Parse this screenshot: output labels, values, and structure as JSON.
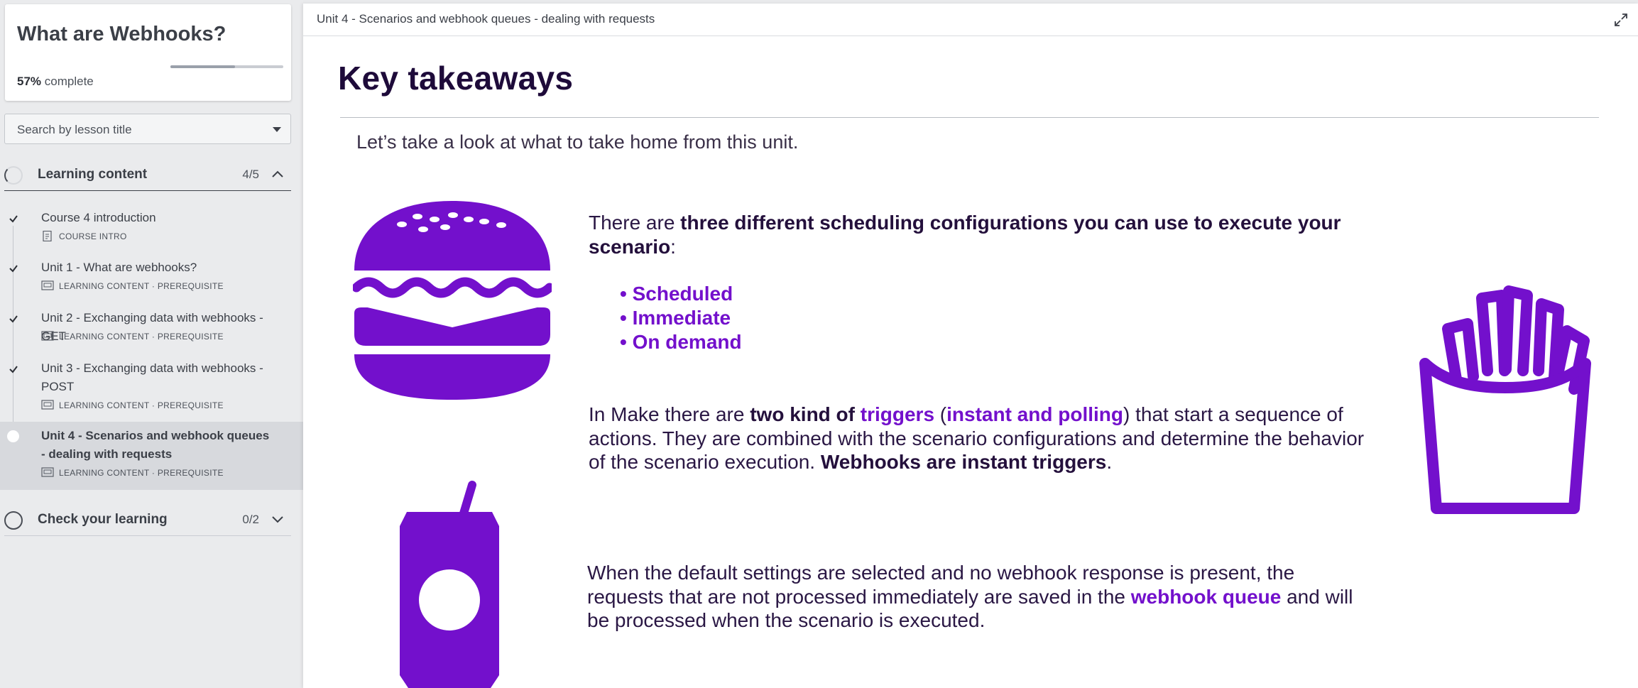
{
  "course": {
    "title": "What are Webhooks?",
    "progress_percent": "57%",
    "progress_label": "complete",
    "progress_fraction": 0.57
  },
  "search": {
    "placeholder": "Search by lesson title"
  },
  "sections": [
    {
      "label": "Learning content",
      "count": "4/5",
      "icon": "chevron-up-icon"
    },
    {
      "label": "Check your learning",
      "count": "0/2",
      "icon": "chevron-down-icon"
    }
  ],
  "lessons": [
    {
      "title": "Course 4 introduction",
      "meta": "COURSE INTRO",
      "status": "complete"
    },
    {
      "title": "Unit 1 - What are webhooks?",
      "meta": "LEARNING CONTENT · PREREQUISITE",
      "status": "complete"
    },
    {
      "title": "Unit 2 - Exchanging data with webhooks - GET",
      "meta": "LEARNING CONTENT · PREREQUISITE",
      "status": "complete"
    },
    {
      "title": "Unit 3 - Exchanging data with webhooks - POST",
      "meta": "LEARNING CONTENT · PREREQUISITE",
      "status": "complete"
    },
    {
      "title": "Unit 4 - Scenarios and webhook queues - dealing with requests",
      "meta": "LEARNING CONTENT · PREREQUISITE",
      "status": "current"
    }
  ],
  "main": {
    "breadcrumb": "Unit 4 - Scenarios and webhook queues - dealing with requests",
    "title": "Key takeaways",
    "intro": "Let’s take a look at what to take home from this unit.",
    "p1": {
      "a": "There are ",
      "b": "three different scheduling configurations you can use to execute your scenario",
      "c": ":"
    },
    "bullets": [
      "Scheduled",
      "Immediate",
      "On demand"
    ],
    "p2": {
      "a": "In Make there are ",
      "b": "two kind of ",
      "c": "triggers",
      "d": " (",
      "e": "instant and polling",
      "f": ") that start a sequence of actions. They are combined with the scenario configurations and determine the behavior of the scenario execution. ",
      "g": "Webhooks are instant triggers",
      "h": "."
    },
    "p3": {
      "a": "When the default settings are selected and no webhook response is present, the requests that are not processed immediately are saved in the ",
      "b": "webhook queue",
      "c": " and will be processed when the scenario is executed."
    }
  },
  "colors": {
    "accent": "#7310cc",
    "heading": "#1e0b3a",
    "sidebar_bg": "#eaebed"
  },
  "icons": [
    "burger-icon",
    "fries-icon",
    "soda-can-icon",
    "expand-icon",
    "check-icon",
    "course-intro-icon",
    "learning-content-icon"
  ]
}
